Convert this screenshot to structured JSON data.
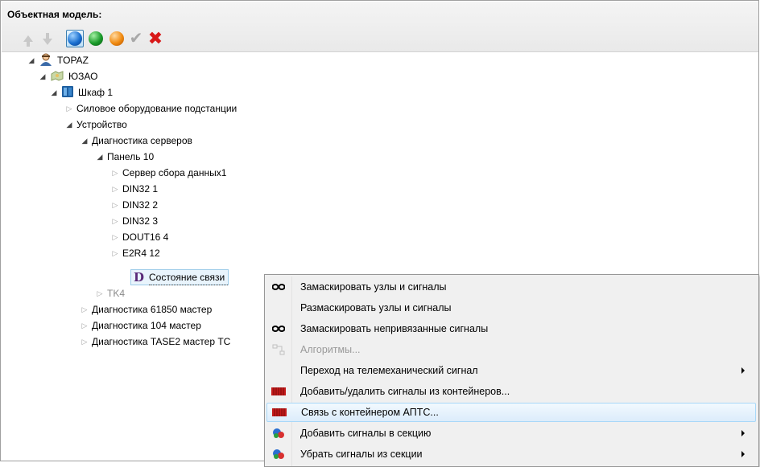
{
  "panel": {
    "title": "Объектная модель:"
  },
  "toolbar": {
    "buttons": [
      {
        "name": "move-up-button",
        "icon": "arrow-up-icon",
        "enabled": false
      },
      {
        "name": "move-down-button",
        "icon": "arrow-down-icon",
        "enabled": false
      },
      {
        "name": "blue-state-button",
        "icon": "blue-ball-icon",
        "selected": true
      },
      {
        "name": "green-state-button",
        "icon": "green-ball-icon"
      },
      {
        "name": "orange-state-button",
        "icon": "orange-ball-icon"
      },
      {
        "name": "apply-button",
        "icon": "checkmark-icon",
        "enabled": false
      },
      {
        "name": "delete-button",
        "icon": "red-cross-icon"
      }
    ]
  },
  "tree": {
    "nodes": [
      {
        "label": "TOPAZ",
        "expanded": true,
        "icon": "user-icon"
      },
      {
        "label": "ЮЗАО",
        "expanded": true,
        "icon": "map-region-icon"
      },
      {
        "label": "Шкаф 1",
        "expanded": true,
        "icon": "cabinet-icon"
      },
      {
        "label": "Силовое оборудование подстанции",
        "expanded": false
      },
      {
        "label": "Устройство",
        "expanded": true
      },
      {
        "label": "Диагностика серверов",
        "expanded": true
      },
      {
        "label": "Панель 10",
        "expanded": true
      },
      {
        "label": "Сервер сбора данных1",
        "expanded": false
      },
      {
        "label": "DIN32 1",
        "expanded": false
      },
      {
        "label": "DIN32 2",
        "expanded": false
      },
      {
        "label": "DIN32 3",
        "expanded": false
      },
      {
        "label": "DOUT16 4",
        "expanded": false
      },
      {
        "label": "E2R4 12",
        "expanded": false
      },
      {
        "label": "Состояние связи",
        "selected": true,
        "icon": "d-letter-icon"
      },
      {
        "label": "TK4",
        "expanded": false,
        "muted": true
      },
      {
        "label": "Диагностика 61850 мастер",
        "expanded": false
      },
      {
        "label": "Диагностика 104 мастер",
        "expanded": false
      },
      {
        "label": "Диагностика TASE2 мастер TC",
        "expanded": false
      }
    ]
  },
  "context_menu": {
    "items": [
      {
        "label": "Замаскировать узлы и сигналы",
        "icon": "mask-icon"
      },
      {
        "label": "Размаскировать узлы и сигналы"
      },
      {
        "label": "Замаскировать непривязанные сигналы",
        "icon": "mask-icon"
      },
      {
        "label": "Алгоритмы...",
        "icon": "algorithm-icon",
        "disabled": true
      },
      {
        "label": "Переход на телемеханический сигнал",
        "submenu": true
      },
      {
        "label": "Добавить/удалить сигналы из контейнеров...",
        "icon": "container-icon"
      },
      {
        "label": "Связь с контейнером АПТС...",
        "icon": "container-icon",
        "hover": true
      },
      {
        "label": "Добавить сигналы в секцию",
        "icon": "section-signals-icon",
        "submenu": true
      },
      {
        "label": "Убрать сигналы из секции",
        "icon": "section-signals-icon",
        "submenu": true
      }
    ]
  },
  "colors": {
    "selection_bg": "#e9f4fc",
    "selection_border": "#9ccbe9",
    "menu_bg": "#f0f0f0",
    "delete_red": "#d81818"
  }
}
